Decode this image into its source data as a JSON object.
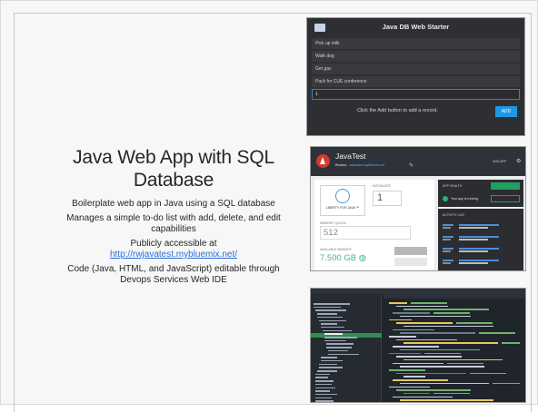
{
  "slide": {
    "title": "Java Web App with SQL Database",
    "bullets": [
      "Boilerplate web app in Java using a SQL database",
      "Manages a simple to-do list with add, delete, and edit capabilities",
      "Publicly accessible at"
    ],
    "link": "http://rwjavatest.mybluemix.net/",
    "last_bullet": "Code (Java, HTML, and JavaScript) editable through Devops Services Web IDE"
  },
  "db_starter": {
    "title": "Java DB Web Starter",
    "items": [
      "Pick up milk",
      "Walk dog",
      "Get gas",
      "Pack for CUE conference"
    ],
    "input_value": "1",
    "hint": "Click the Add button to add a record.",
    "add_label": "ADD",
    "logo_icon": "app-logo-icon"
  },
  "dashboard": {
    "app_name": "JavaTest",
    "routes_label": "Routes:",
    "route_url": "rwjavatest.mybluemix.net",
    "add_app_label": "ADD APP",
    "runtime_label": "LIBERTY FOR JAVA ™",
    "instances_label": "INSTANCES",
    "instances_value": "1",
    "memory_label": "MEMORY QUOTA",
    "memory_value": "512",
    "available_label": "AVAILABLE MEMORY",
    "available_value": "7.500 GB",
    "health_label": "APP HEALTH",
    "status_text": "Your app is running.",
    "activity_label": "ACTIVITY LOG",
    "activity_rows": 4,
    "colors": {
      "topbar": "#2f3238",
      "running": "#26b573",
      "link": "#4a8fd8"
    }
  },
  "ide": {
    "theme": "dark",
    "colors": {
      "keyword": "#e3c75a",
      "string": "#6fb36b",
      "comment": "#6b7a8c",
      "default": "#c8ced8",
      "selection": "#2f8f4e"
    }
  }
}
